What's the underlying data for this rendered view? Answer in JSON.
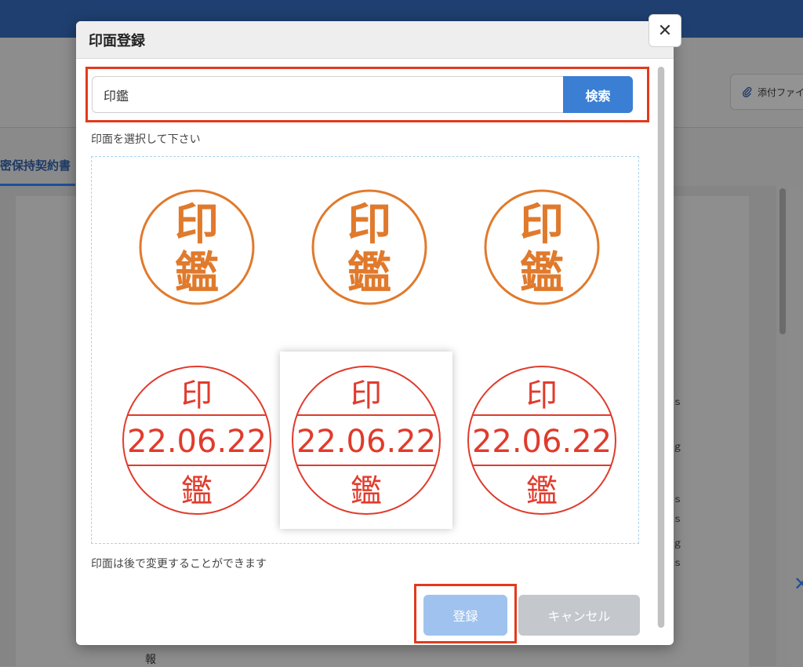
{
  "background": {
    "attach_button_label": "添付ファイ",
    "document_tab_label": "密保持契約書",
    "text_fragment": "報",
    "side_marks": [
      "ｓ",
      "ｇ",
      "ｓ",
      "ｓ",
      "ｇ",
      "ｓ"
    ]
  },
  "modal": {
    "title": "印面登録",
    "close_icon": "close-icon",
    "search": {
      "value": "印鑑",
      "placeholder": "",
      "button_label": "検索"
    },
    "instruction": "印面を選択して下さい",
    "stamps": [
      {
        "type": "name",
        "top": "印",
        "bottom": "鑑",
        "color": "#e07a2c"
      },
      {
        "type": "name",
        "top": "印",
        "bottom": "鑑",
        "color": "#e07a2c"
      },
      {
        "type": "name",
        "top": "印",
        "bottom": "鑑",
        "color": "#e07a2c"
      },
      {
        "type": "date",
        "top": "印",
        "date": "22.06.22",
        "bottom": "鑑",
        "color": "#e03b2c"
      },
      {
        "type": "date",
        "top": "印",
        "date": "22.06.22",
        "bottom": "鑑",
        "color": "#e03b2c",
        "selected": true
      },
      {
        "type": "date",
        "top": "印",
        "date": "22.06.22",
        "bottom": "鑑",
        "color": "#e03b2c"
      }
    ],
    "note": "印面は後で変更することができます",
    "register_label": "登録",
    "cancel_label": "キャンセル",
    "colors": {
      "primary": "#3b7fd4",
      "primary_disabled": "#9fc3ee",
      "highlight": "#e23a1e",
      "cancel": "#c4c7cb"
    }
  }
}
